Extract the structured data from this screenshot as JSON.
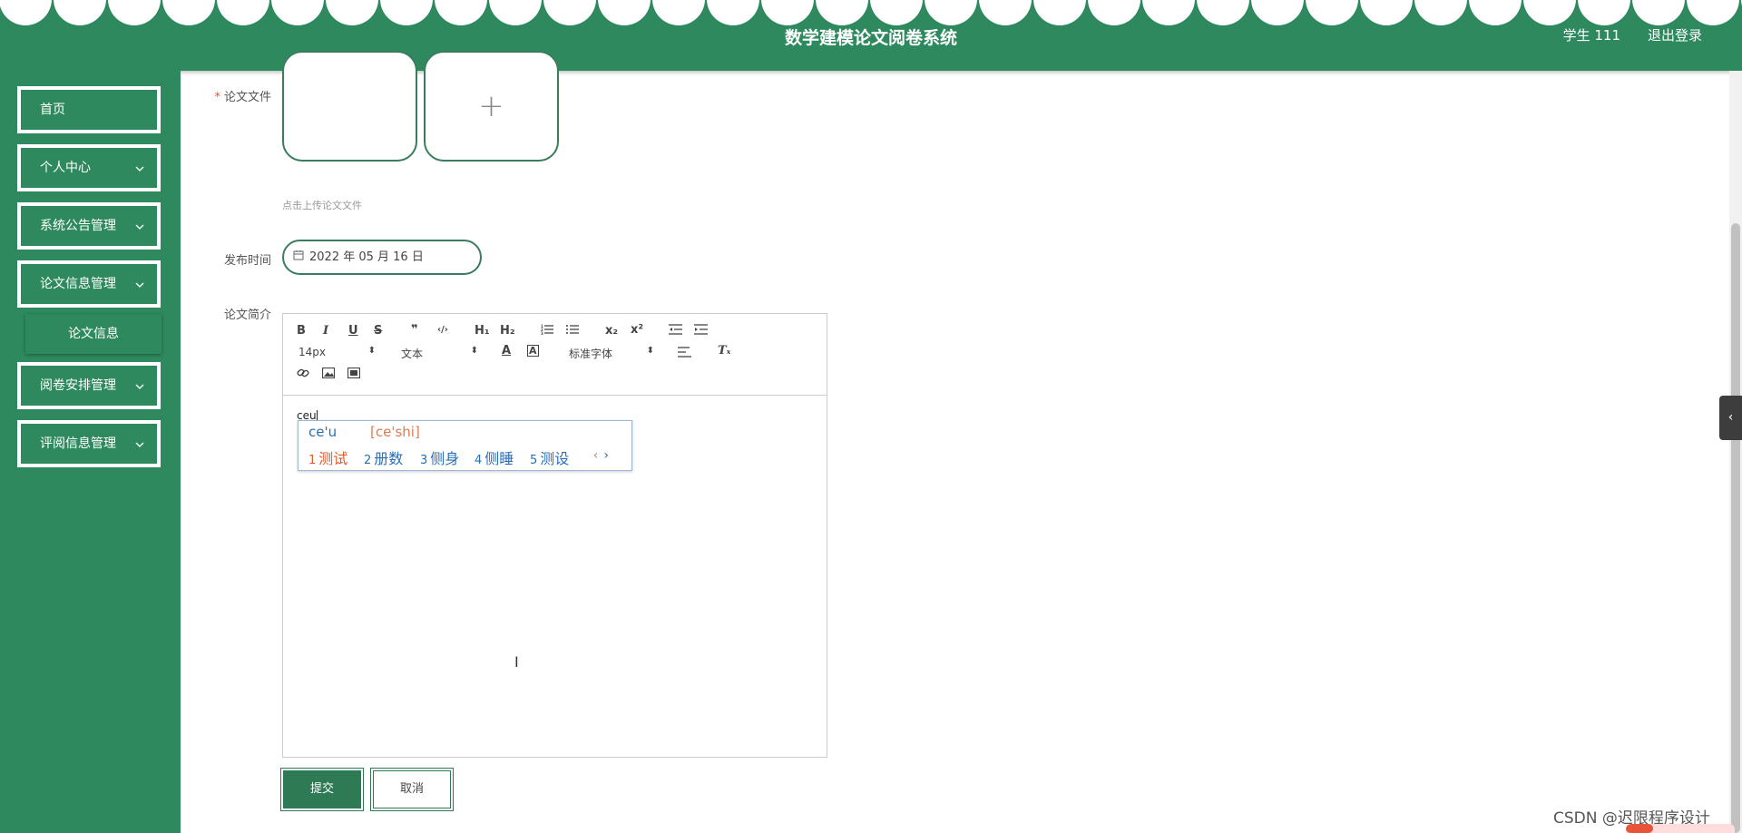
{
  "header": {
    "title": "数学建模论文阅卷系统",
    "user": "学生 111",
    "logout": "退出登录"
  },
  "sidebar": {
    "items": [
      {
        "label": "首页"
      },
      {
        "label": "个人中心"
      },
      {
        "label": "系统公告管理"
      },
      {
        "label": "论文信息管理"
      },
      {
        "label": "论文信息"
      },
      {
        "label": "阅卷安排管理"
      },
      {
        "label": "评阅信息管理"
      }
    ]
  },
  "form": {
    "file_label": "论文文件",
    "required_mark": "*",
    "upload_plus": "+",
    "upload_tip": "点击上传论文文件",
    "date_label": "发布时间",
    "date_value": "2022 年 05 月 16 日",
    "intro_label": "论文简介",
    "submit": "提交",
    "cancel": "取消"
  },
  "editor": {
    "toolbar": {
      "bold": "B",
      "italic": "I",
      "underline": "U",
      "strike": "S",
      "quote": "❞",
      "code": "‹/›",
      "h1": "H₁",
      "h2": "H₂",
      "subscript": "x₂",
      "superscript": "x²",
      "font_size": "14px",
      "format": "文本",
      "font_family": "标准字体",
      "clean": "Tₓ"
    },
    "content": "ceu"
  },
  "ime": {
    "pinyin": "ce'u",
    "hint": "[ce'shi]",
    "candidates": [
      {
        "n": "1",
        "text": "测试"
      },
      {
        "n": "2",
        "text": "册数"
      },
      {
        "n": "3",
        "text": "侧身"
      },
      {
        "n": "4",
        "text": "侧睡"
      },
      {
        "n": "5",
        "text": "测设"
      }
    ],
    "prev": "‹",
    "next": "›"
  },
  "watermark": "CSDN @迟限程序设计",
  "colors": {
    "primary": "#2e8a5e",
    "accent": "#e05a2b"
  }
}
